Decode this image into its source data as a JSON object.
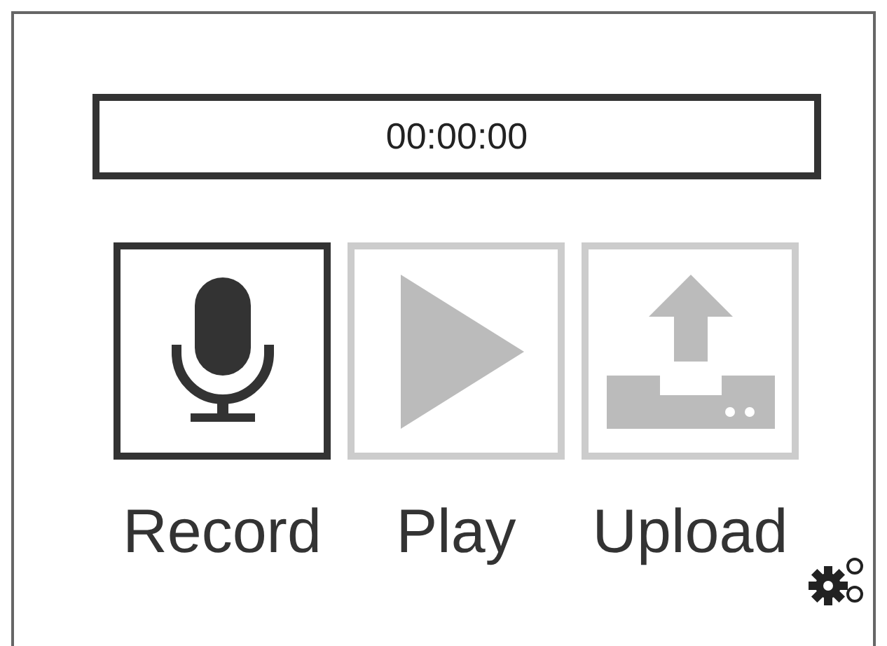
{
  "timer": {
    "value": "00:00:00"
  },
  "buttons": [
    {
      "kind": "record",
      "label": "Record",
      "disabled": false
    },
    {
      "kind": "play",
      "label": "Play",
      "disabled": true
    },
    {
      "kind": "upload",
      "label": "Upload",
      "disabled": true
    }
  ]
}
